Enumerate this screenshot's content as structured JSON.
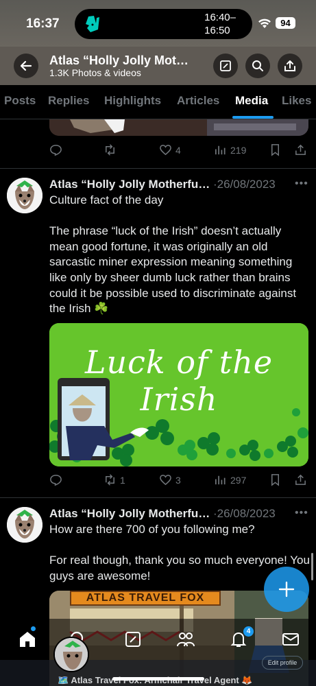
{
  "status_bar": {
    "time": "16:37",
    "island_time_top": "16:40–",
    "island_time_bottom": "16:50",
    "battery": "94",
    "island_app_icon": "deliveroo-kangaroo-icon"
  },
  "header": {
    "title": "Atlas “Holly Jolly Mot…",
    "subtitle": "1.3K Photos & videos",
    "icons": [
      "back-arrow-icon",
      "compose-icon",
      "search-icon",
      "share-icon"
    ]
  },
  "tabs": [
    {
      "label": "Posts",
      "active": false
    },
    {
      "label": "Replies",
      "active": false
    },
    {
      "label": "Highlights",
      "active": false
    },
    {
      "label": "Articles",
      "active": false
    },
    {
      "label": "Media",
      "active": true
    },
    {
      "label": "Likes",
      "active": false
    }
  ],
  "previous_post": {
    "likes": "4",
    "views": "219"
  },
  "posts": [
    {
      "name": "Atlas “Holly Jolly Motherfu…",
      "date": "·26/08/2023",
      "text": "Culture fact of the day\n\nThe phrase “luck of the Irish” doesn’t actually mean good fortune, it was originally an old sarcastic miner expression meaning something like only by sheer dumb luck rather than brains could it be possible used to discriminate against the Irish ☘️",
      "media_text": "Luck of the Irish",
      "reposts": "1",
      "likes": "3",
      "views": "297"
    },
    {
      "name": "Atlas “Holly Jolly Motherfu…",
      "date": "·26/08/2023",
      "text": "How are there 700 of you following me?\n\nFor real though, thank you so much everyone! You guys are awesome!",
      "media_text": "ATLAS TRAVEL FOX"
    }
  ],
  "bottom_nav": {
    "notification_badge": "4",
    "icons": [
      "home-icon",
      "search-icon",
      "compose-icon",
      "communities-icon",
      "notifications-icon",
      "messages-icon"
    ]
  },
  "profile_overlay": {
    "name": "🗺️ Atlas Travel Fox: Armchair Travel Agent 🦊",
    "edit_button": "Edit profile"
  },
  "colors": {
    "accent": "#1d9bf0",
    "background": "#000000",
    "secondary_text": "#71767b"
  }
}
